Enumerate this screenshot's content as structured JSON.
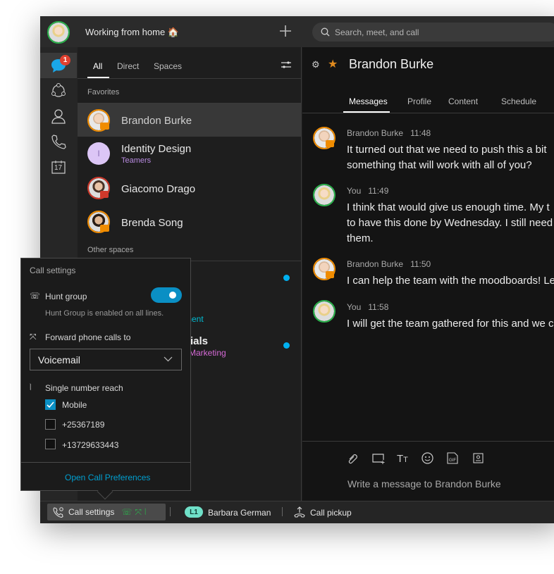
{
  "header": {
    "status": "Working from home 🏠",
    "search_placeholder": "Search, meet, and call"
  },
  "nav": {
    "messages_badge": "1",
    "calendar_day": "17"
  },
  "list": {
    "tabs": [
      "All",
      "Direct",
      "Spaces"
    ],
    "favorites_label": "Favorites",
    "favorites": [
      {
        "name": "Brandon Burke",
        "presence": "video"
      },
      {
        "name": "Identity Design",
        "subtitle": "Teamers",
        "initial": "I"
      },
      {
        "name": "Giacomo Drago",
        "presence": "in-call"
      },
      {
        "name": "Brenda Song",
        "presence": "video"
      }
    ],
    "other_label": "Other spaces",
    "other_partial": [
      {
        "subtitle": "ment"
      },
      {
        "name": "ials",
        "subtitle": "Marketing"
      }
    ]
  },
  "conversation": {
    "title": "Brandon Burke",
    "tabs": [
      "Messages",
      "Profile",
      "Content",
      "Schedule"
    ],
    "messages": [
      {
        "sender": "Brandon Burke",
        "time": "11:48",
        "lines": [
          "It turned out that we need to push this a bit",
          "something that will work with all of you?"
        ]
      },
      {
        "sender": "You",
        "time": "11:49",
        "lines": [
          "I think that would give us enough time. My t",
          "to have this done by Wednesday. I still need",
          "them."
        ]
      },
      {
        "sender": "Brandon Burke",
        "time": "11:50",
        "lines": [
          "I can help the team with the moodboards! Le"
        ]
      },
      {
        "sender": "You",
        "time": "11:58",
        "lines": [
          "I will get the team gathered for this and we c"
        ]
      }
    ],
    "composer_placeholder": "Write a message to Brandon Burke"
  },
  "popup": {
    "title": "Call settings",
    "hunt_label": "Hunt group",
    "hunt_enabled": true,
    "hunt_note": "Hunt Group is enabled on all lines.",
    "forward_label": "Forward phone calls to",
    "forward_value": "Voicemail",
    "snr_label": "Single number reach",
    "snr_options": [
      {
        "label": "Mobile",
        "checked": true
      },
      {
        "label": "+25367189",
        "checked": false
      },
      {
        "label": "+13729633443",
        "checked": false
      }
    ],
    "link": "Open Call Preferences"
  },
  "bottom": {
    "call_settings": "Call settings",
    "line_badge": "L1",
    "line_name": "Barbara German",
    "pickup": "Call pickup"
  },
  "colors": {
    "accent": "#00a0d1",
    "toggle": "#0a8fc4",
    "presence_video": "#f08c00",
    "status_green": "#2bb24c",
    "teamers": "#b88be0",
    "marketing": "#d56ad6",
    "cyan_text": "#00bcd4",
    "badge_red": "#e0402f"
  }
}
